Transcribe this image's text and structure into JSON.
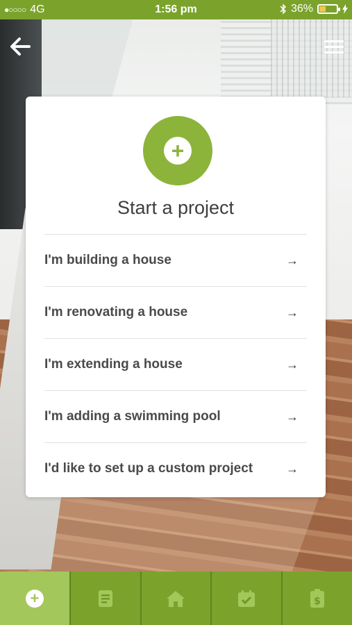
{
  "status_bar": {
    "signal": "●○○○○",
    "network": "4G",
    "time": "1:56 pm",
    "battery_percent": "36%",
    "battery_level": 0.36
  },
  "nav": {
    "back_icon": "arrow-left-icon",
    "menu_icon": "hamburger-menu-icon"
  },
  "card": {
    "icon": "plus-circle-icon",
    "title": "Start a project",
    "options": [
      {
        "label": "I'm building a house",
        "icon": "arrow-right-icon"
      },
      {
        "label": "I'm renovating a house",
        "icon": "arrow-right-icon"
      },
      {
        "label": "I'm extending a house",
        "icon": "arrow-right-icon"
      },
      {
        "label": "I'm adding a swimming pool",
        "icon": "arrow-right-icon"
      },
      {
        "label": "I'd like to set up a custom project",
        "icon": "arrow-right-icon"
      }
    ]
  },
  "tabbar": {
    "tabs": [
      {
        "icon": "add-project-icon",
        "active": true
      },
      {
        "icon": "document-icon",
        "active": false
      },
      {
        "icon": "home-icon",
        "active": false
      },
      {
        "icon": "calendar-check-icon",
        "active": false
      },
      {
        "icon": "budget-clipboard-icon",
        "active": false
      }
    ]
  },
  "colors": {
    "brand_green": "#7ba32c",
    "accent_green": "#8cb43b",
    "active_tab": "#a3c75a"
  }
}
